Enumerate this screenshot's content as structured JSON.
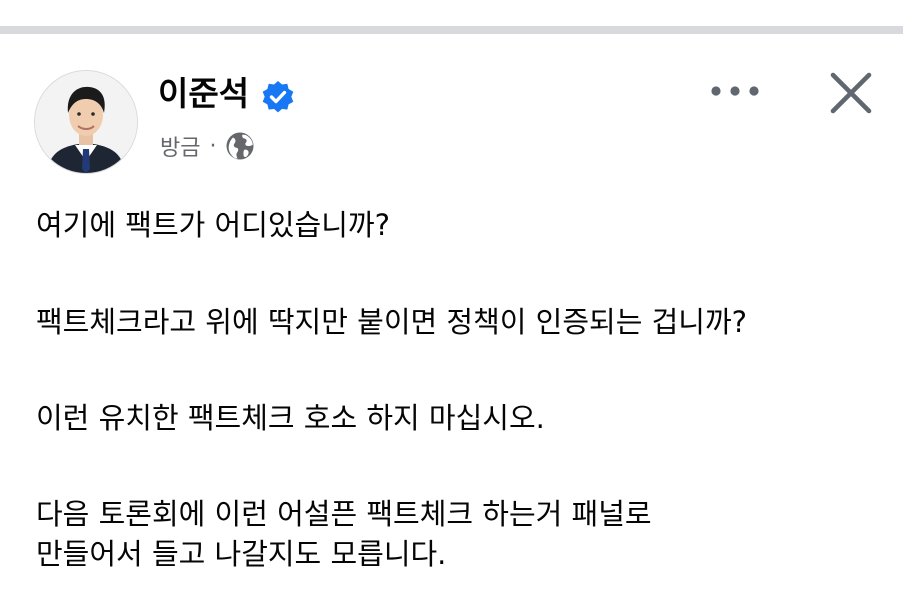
{
  "post": {
    "author": {
      "name": "이준석",
      "verified": true
    },
    "timestamp": "방금",
    "meta_separator": "·",
    "privacy_icon": "globe-icon",
    "paragraphs": [
      [
        "여기에 팩트가 어디있습니까?"
      ],
      [
        "팩트체크라고 위에 딱지만 붙이면 정책이 인증되는 겁니까?"
      ],
      [
        "이런 유치한 팩트체크 호소 하지 마십시오."
      ],
      [
        "다음 토론회에 이런 어설픈 팩트체크 하는거 패널로",
        "만들어서 들고 나갈지도 모릅니다."
      ]
    ]
  },
  "header": {
    "more_icon": "more-horizontal-icon",
    "close_icon": "close-icon"
  },
  "colors": {
    "divider": "#d7d9dd",
    "verified_blue": "#1877f2",
    "meta_gray": "#65676b",
    "text": "#050505"
  }
}
